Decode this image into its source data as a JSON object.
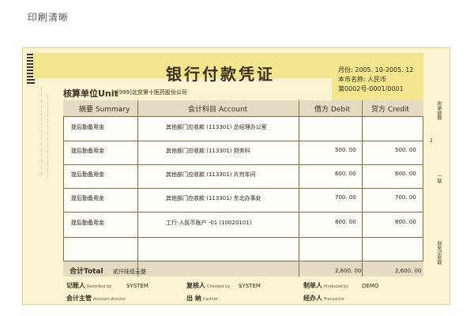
{
  "caption": "印刷清晰",
  "voucher": {
    "title": "银行付款凭证",
    "account_unit_label": "核算单位Unit",
    "account_unit_value": "[999]北京第十医药股份公司",
    "month": "月份: 2005. 10-2005. 12",
    "currency": "本币名称: 人民币",
    "number": "第0002号-0001/0001",
    "headers": {
      "summary": "摘要 Summary",
      "account": "会计科目 Account",
      "debit": "借方 Debit",
      "credit": "贷方 Credit"
    },
    "rows": [
      {
        "summary": "提后勤备用金",
        "account": "其他部门应收款    (113301) 总经理办公室",
        "debit": "",
        "credit": ""
      },
      {
        "summary": "提后勤备用金",
        "account": "其他部门应收款    (113301) 财务科",
        "debit": "500. 00",
        "credit": "500. 00"
      },
      {
        "summary": "提后勤备用金",
        "account": "其他部门应收款    (113301) 片剂车间",
        "debit": "600. 00",
        "credit": "600. 00"
      },
      {
        "summary": "提后勤备用金",
        "account": "其他部门应收款    (113301) 东北办事处",
        "debit": "700. 00",
        "credit": "700. 00"
      },
      {
        "summary": "提后勤备用金",
        "account": "工行-人民币账户 -01 (10020101)",
        "debit": "800. 00",
        "credit": "800. 00"
      },
      {
        "summary": "",
        "account": "",
        "debit": "",
        "credit": ""
      }
    ],
    "total": {
      "label": "合计Total",
      "words": "贰仟陆佰元整",
      "debit": "2,600. 00",
      "credit": "2,600. 00"
    },
    "signatures": {
      "recorded_label": "记账人",
      "recorded_sub": "Recorded by",
      "recorded_value": "SYSTEM",
      "checked_label": "复核人",
      "checked_sub": "Checked by",
      "checked_value": "SYSTEM",
      "produced_label": "制单人",
      "produced_sub": "Produced by",
      "produced_value": "DEMO",
      "director_label": "会计主管",
      "director_sub": "Account director",
      "cashier_label": "出 纳",
      "cashier_sub": "Cashier",
      "transactor_label": "经办人",
      "transactor_sub": "Transactor"
    },
    "right_strip": {
      "attach_label": "附单据数",
      "attach_count": "2",
      "page_label": "一联",
      "keep_label": "财务记账联"
    }
  }
}
